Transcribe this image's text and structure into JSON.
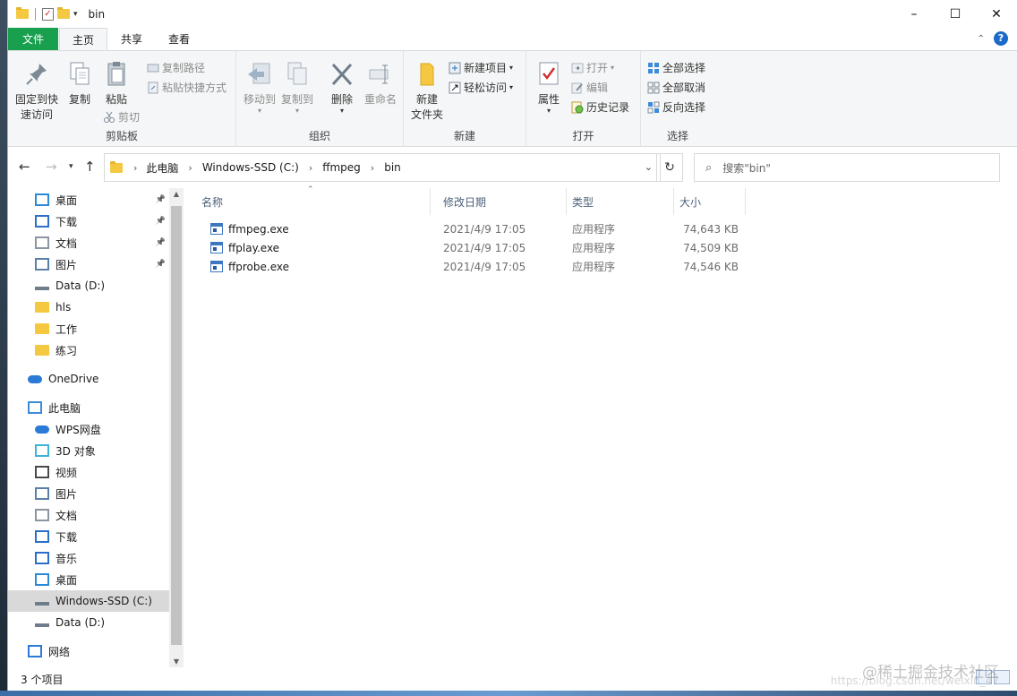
{
  "window": {
    "title": "bin",
    "controls": [
      "–",
      "☐",
      "✕"
    ]
  },
  "tabs": [
    {
      "label": "文件"
    },
    {
      "label": "主页"
    },
    {
      "label": "共享"
    },
    {
      "label": "查看"
    }
  ],
  "ribbon": {
    "clipboard": {
      "pin_label_1": "固定到快",
      "pin_label_2": "速访问",
      "copy": "复制",
      "paste": "粘贴",
      "copy_path": "复制路径",
      "paste_shortcut": "粘贴快捷方式",
      "cut": "剪切",
      "group": "剪贴板"
    },
    "organize": {
      "move_to": "移动到",
      "copy_to": "复制到",
      "delete": "删除",
      "rename": "重命名",
      "group": "组织"
    },
    "new": {
      "new_folder_1": "新建",
      "new_folder_2": "文件夹",
      "new_item": "新建项目",
      "easy_access": "轻松访问",
      "group": "新建"
    },
    "open": {
      "properties": "属性",
      "open": "打开",
      "edit": "编辑",
      "history": "历史记录",
      "group": "打开"
    },
    "select": {
      "select_all": "全部选择",
      "select_none": "全部取消",
      "invert": "反向选择",
      "group": "选择"
    }
  },
  "address": {
    "crumbs": [
      "此电脑",
      "Windows-SSD (C:)",
      "ffmpeg",
      "bin"
    ],
    "search_placeholder": "搜索\"bin\""
  },
  "nav": [
    {
      "label": "桌面",
      "icon": "desktop-icon",
      "pinned": true
    },
    {
      "label": "下载",
      "icon": "download-icon",
      "pinned": true
    },
    {
      "label": "文档",
      "icon": "document-icon",
      "pinned": true
    },
    {
      "label": "图片",
      "icon": "picture-icon",
      "pinned": true
    },
    {
      "label": "Data (D:)",
      "icon": "drive-icon",
      "pinned": false
    },
    {
      "label": "hls",
      "icon": "folder-icon",
      "pinned": false
    },
    {
      "label": "工作",
      "icon": "folder-icon",
      "pinned": false
    },
    {
      "label": "练习",
      "icon": "folder-icon",
      "pinned": false
    },
    {
      "label": "OneDrive",
      "icon": "cloud-icon",
      "pinned": false
    },
    {
      "label": "此电脑",
      "icon": "computer-icon",
      "pinned": false
    },
    {
      "label": "WPS网盘",
      "icon": "cloud-icon",
      "pinned": false
    },
    {
      "label": "3D 对象",
      "icon": "cube-icon",
      "pinned": false
    },
    {
      "label": "视频",
      "icon": "video-icon",
      "pinned": false
    },
    {
      "label": "图片",
      "icon": "picture-icon",
      "pinned": false
    },
    {
      "label": "文档",
      "icon": "document-icon",
      "pinned": false
    },
    {
      "label": "下载",
      "icon": "download-icon",
      "pinned": false
    },
    {
      "label": "音乐",
      "icon": "music-icon",
      "pinned": false
    },
    {
      "label": "桌面",
      "icon": "desktop-icon",
      "pinned": false
    },
    {
      "label": "Windows-SSD (C:)",
      "icon": "drive-icon",
      "pinned": false
    },
    {
      "label": "Data (D:)",
      "icon": "drive-icon",
      "pinned": false
    },
    {
      "label": "网络",
      "icon": "network-icon",
      "pinned": false
    }
  ],
  "columns": {
    "name": "名称",
    "modified": "修改日期",
    "type": "类型",
    "size": "大小"
  },
  "files": [
    {
      "name": "ffmpeg.exe",
      "modified": "2021/4/9 17:05",
      "type": "应用程序",
      "size": "74,643 KB"
    },
    {
      "name": "ffplay.exe",
      "modified": "2021/4/9 17:05",
      "type": "应用程序",
      "size": "74,509 KB"
    },
    {
      "name": "ffprobe.exe",
      "modified": "2021/4/9 17:05",
      "type": "应用程序",
      "size": "74,546 KB"
    }
  ],
  "status": {
    "item_count": "3 个项目"
  },
  "watermark": {
    "main": "@稀土掘金技术社区",
    "sub": "https://blog.csdn.net/weixin_47"
  },
  "colors": {
    "file_tab": "#19a04f",
    "accent": "#1b6ac9",
    "selected": "#d9d9d9"
  }
}
